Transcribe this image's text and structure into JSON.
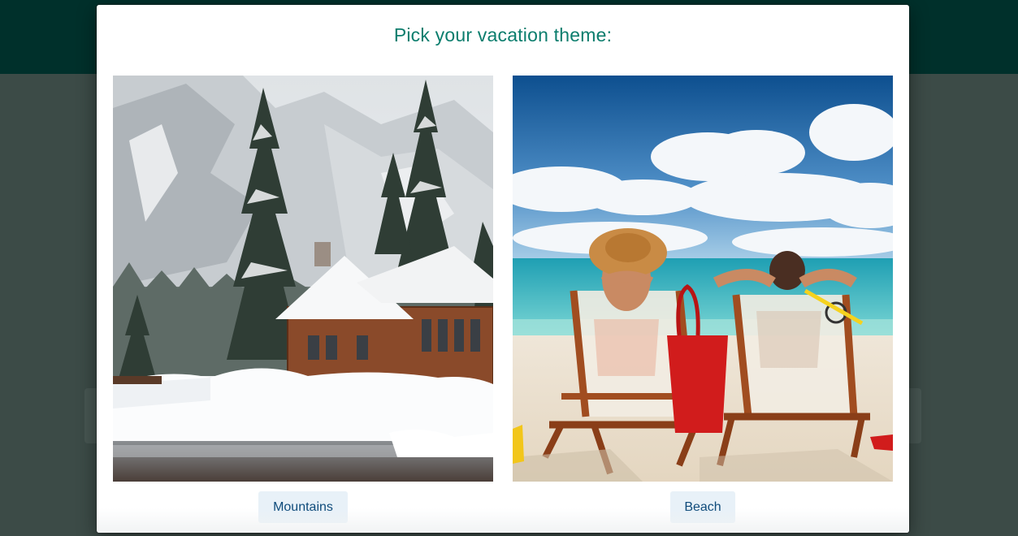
{
  "modal": {
    "title": "Pick your vacation theme:"
  },
  "options": [
    {
      "label": "Mountains",
      "image": "snowy-mountain-cabin-photo"
    },
    {
      "label": "Beach",
      "image": "beach-lounge-chairs-photo"
    }
  ],
  "colors": {
    "title": "#0b7d6d",
    "button_bg": "#e8f1f8",
    "button_text": "#0d4a7a",
    "overlay_header": "#00302b",
    "overlay_body": "#3c4b47"
  }
}
